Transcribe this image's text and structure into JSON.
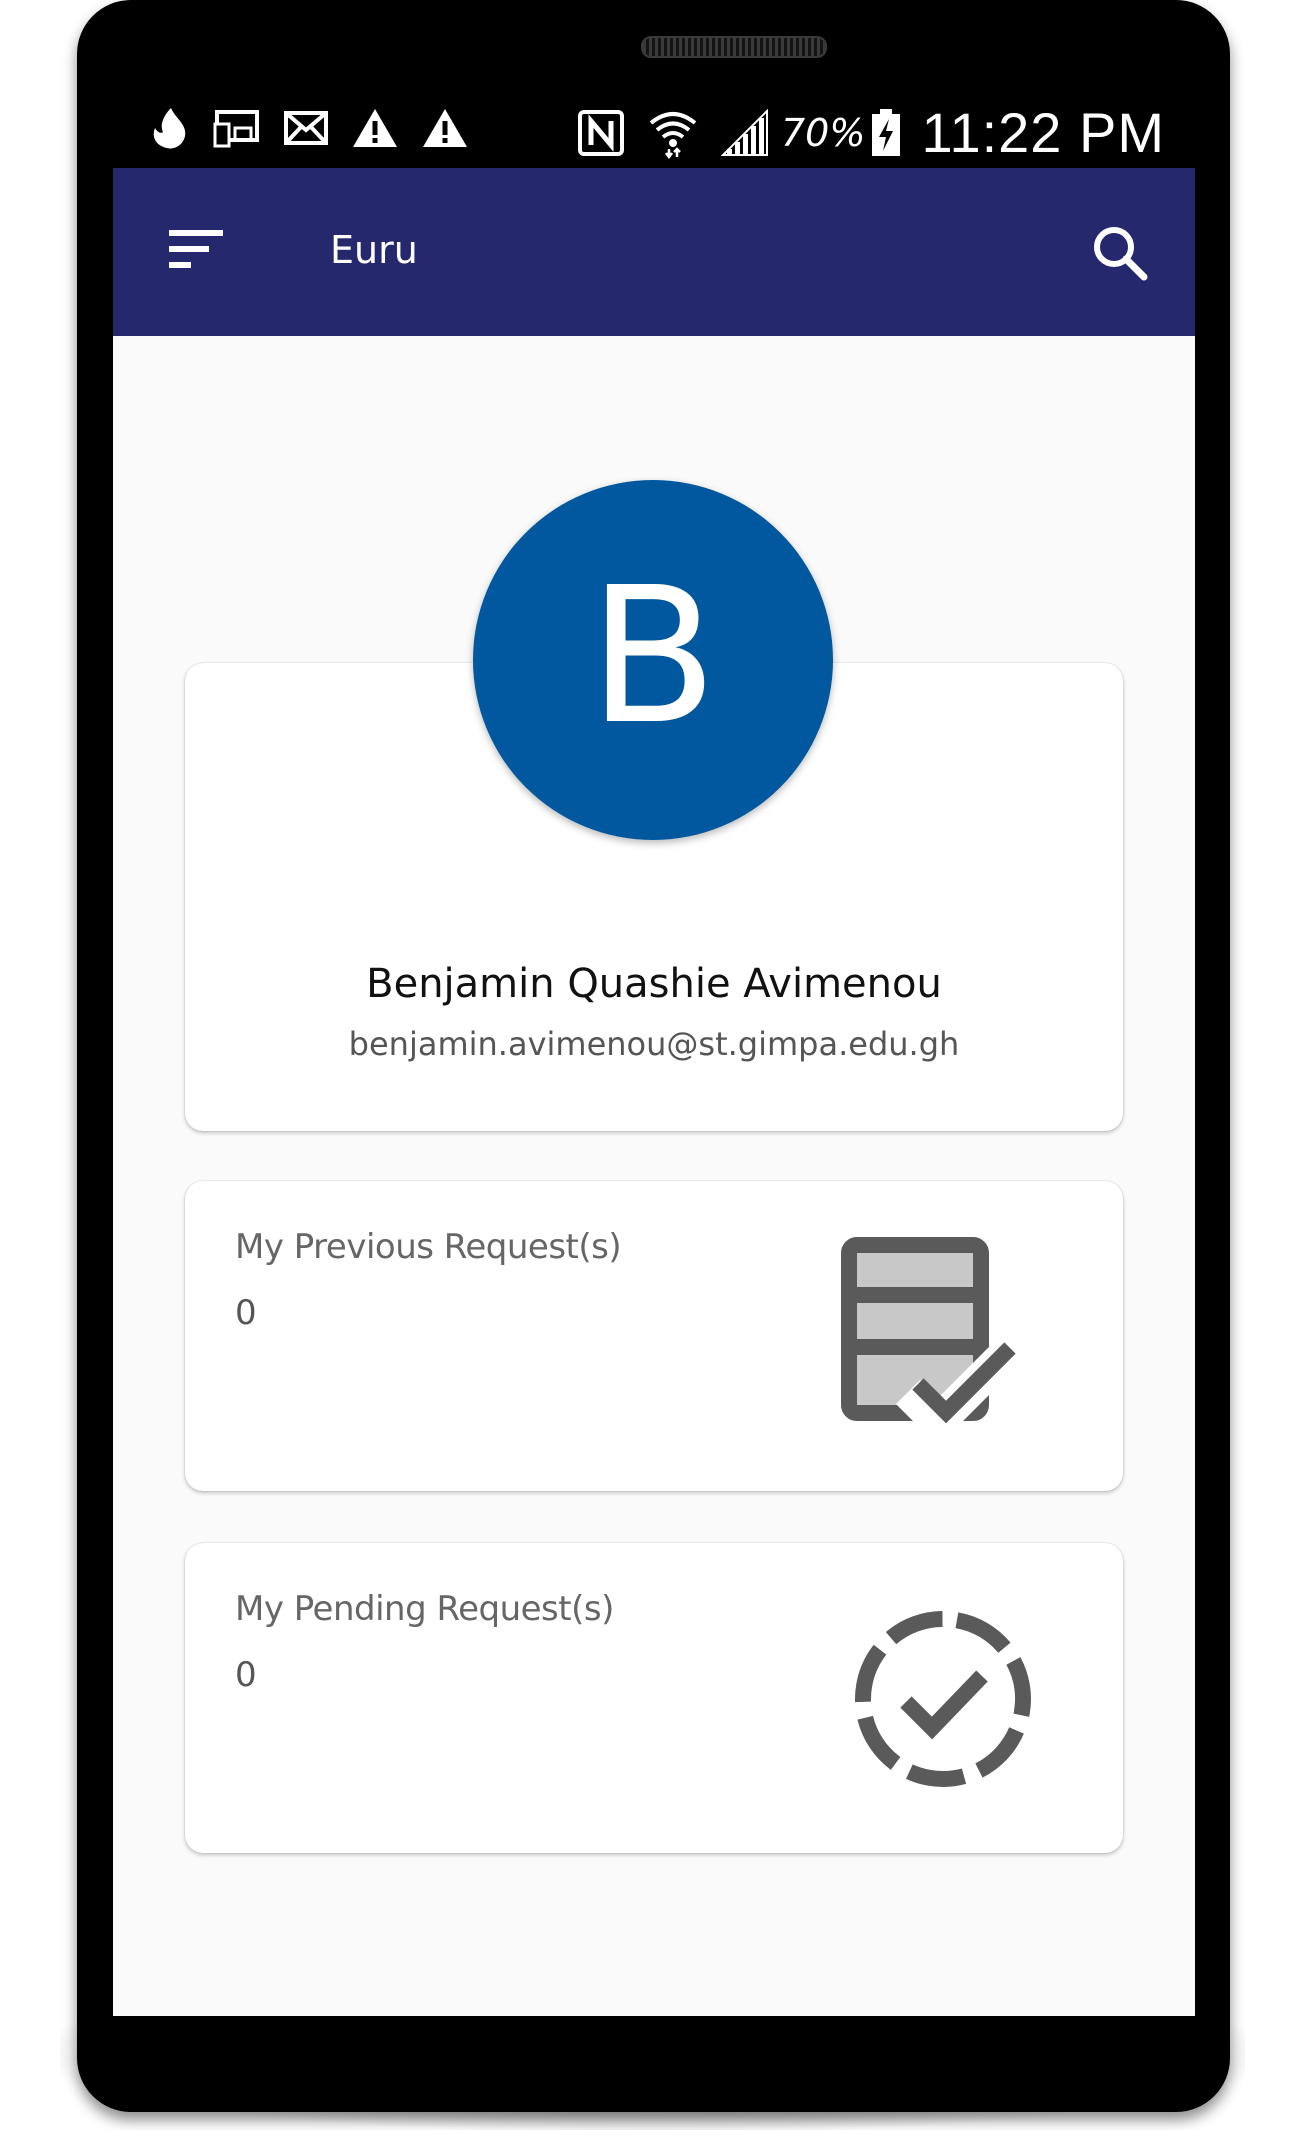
{
  "status_bar": {
    "icons_left": [
      "flame-icon",
      "cast-icon",
      "mail-icon",
      "warning-icon",
      "warning-icon"
    ],
    "icons_right": [
      "nfc-icon",
      "wifi-icon",
      "signal-icon",
      "battery-charging-icon"
    ],
    "battery": "70%",
    "time": "11:22 PM"
  },
  "app_bar": {
    "title": "Euru",
    "menu_icon": "menu-icon",
    "search_icon": "search-icon",
    "color": "#25286c"
  },
  "profile": {
    "avatar_letter": "B",
    "avatar_color": "#02589f",
    "name": "Benjamin Quashie Avimenou",
    "email": "benjamin.avimenou@st.gimpa.edu.gh"
  },
  "requests": [
    {
      "title": "My Previous Request(s)",
      "count": "0",
      "icon": "storage-check-icon"
    },
    {
      "title": "My Pending Request(s)",
      "count": "0",
      "icon": "pending-check-icon"
    }
  ]
}
